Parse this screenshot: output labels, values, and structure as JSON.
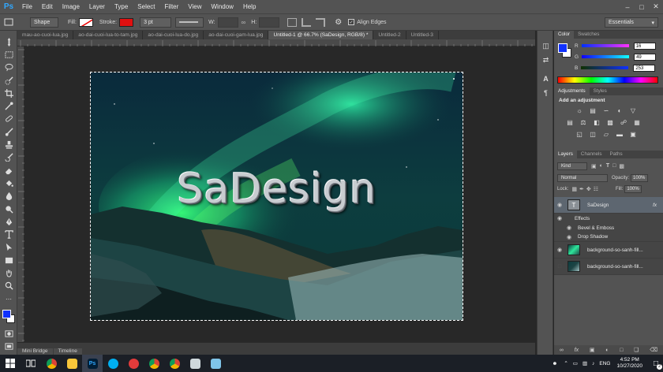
{
  "app": {
    "logo": "Ps"
  },
  "menu": [
    "File",
    "Edit",
    "Image",
    "Layer",
    "Type",
    "Select",
    "Filter",
    "View",
    "Window",
    "Help"
  ],
  "options": {
    "mode": "Shape",
    "fill_label": "Fill:",
    "stroke_label": "Stroke:",
    "stroke_width": "3 pt",
    "w_label": "W:",
    "h_label": "H:",
    "align_edges": "Align Edges",
    "workspace": "Essentials"
  },
  "tabs": [
    "mau-ao-cuoi-lua.jpg",
    "ao-dai-cuoi-lua-to-tam.jpg",
    "ao-dai-cuoi-lua-do.jpg",
    "ao-dai-cuoi-gam-lua.jpg",
    "Untitled-1 @ 66.7% (SaDesign, RGB/8) *",
    "Untitled-2",
    "Untitled-3"
  ],
  "document": {
    "text": "SaDesign"
  },
  "bottom_tabs": [
    "Mini Bridge",
    "Timeline"
  ],
  "color_panel": {
    "tabs": [
      "Color",
      "Swatches"
    ],
    "channels": [
      {
        "label": "R",
        "value": "16"
      },
      {
        "label": "G",
        "value": "49"
      },
      {
        "label": "B",
        "value": "253"
      }
    ],
    "foreground": "#1031fd",
    "background": "#ffffff"
  },
  "adjustments_panel": {
    "tabs": [
      "Adjustments",
      "Styles"
    ],
    "title": "Add an adjustment"
  },
  "layers_panel": {
    "tabs": [
      "Layers",
      "Channels",
      "Paths"
    ],
    "filter": "Kind",
    "blend_mode": "Normal",
    "opacity_label": "Opacity:",
    "opacity": "100%",
    "lock_label": "Lock:",
    "fill_label": "Fill:",
    "fill": "100%",
    "layers": [
      {
        "name": "SaDesign",
        "fx": "fx"
      },
      {
        "name": "Effects"
      },
      {
        "name": "Bevel & Emboss"
      },
      {
        "name": "Drop Shadow"
      },
      {
        "name": "background-so-sanh-fill..."
      },
      {
        "name": "background-so-sanh-fill..."
      }
    ]
  },
  "taskbar": {
    "lang": "ENG",
    "time": "4:52 PM",
    "date": "10/27/2020",
    "notifications": "2"
  }
}
